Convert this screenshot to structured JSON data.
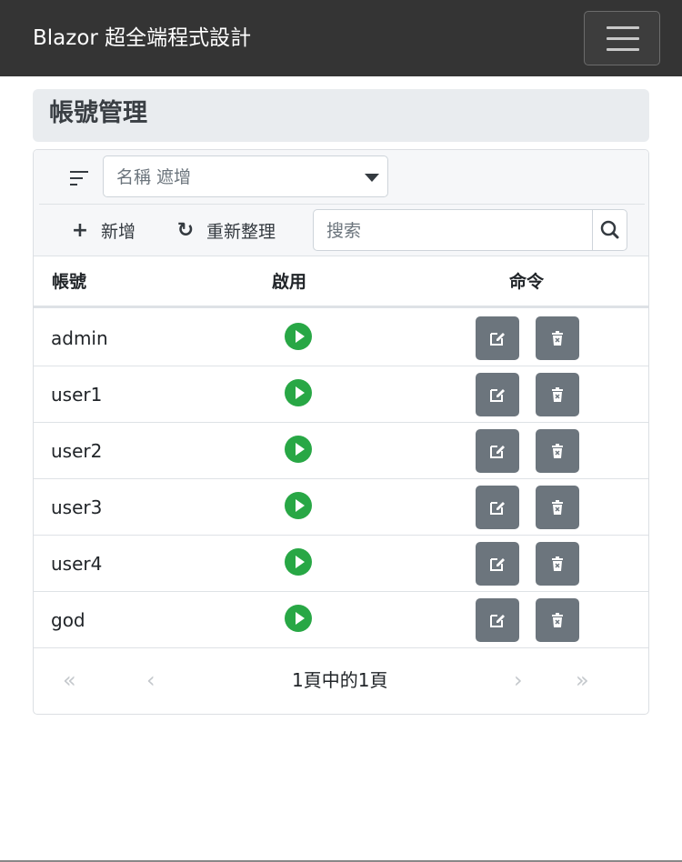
{
  "navbar": {
    "brand": "Blazor 超全端程式設計",
    "toggler_icon": "hamburger-icon"
  },
  "page": {
    "title": "帳號管理"
  },
  "toolbar": {
    "sort_icon": "sort-icon",
    "filter_placeholder": "名稱 遮增",
    "add_label": "新增",
    "add_icon": "+",
    "refresh_label": "重新整理",
    "refresh_icon": "↻",
    "search_placeholder": "搜索",
    "search_icon": "search-icon"
  },
  "table": {
    "headers": {
      "account": "帳號",
      "enabled": "啟用",
      "command": "命令"
    },
    "rows": [
      {
        "account": "admin",
        "enabled": true
      },
      {
        "account": "user1",
        "enabled": true
      },
      {
        "account": "user2",
        "enabled": true
      },
      {
        "account": "user3",
        "enabled": true
      },
      {
        "account": "user4",
        "enabled": true
      },
      {
        "account": "god",
        "enabled": true
      }
    ]
  },
  "pager": {
    "first": "«",
    "prev": "‹",
    "text": "1頁中的1頁",
    "next": "›",
    "last": "»"
  },
  "colors": {
    "navbar": "#343434",
    "enabled": "#28a745",
    "command": "#6c757d",
    "header": "#e9ecef"
  }
}
